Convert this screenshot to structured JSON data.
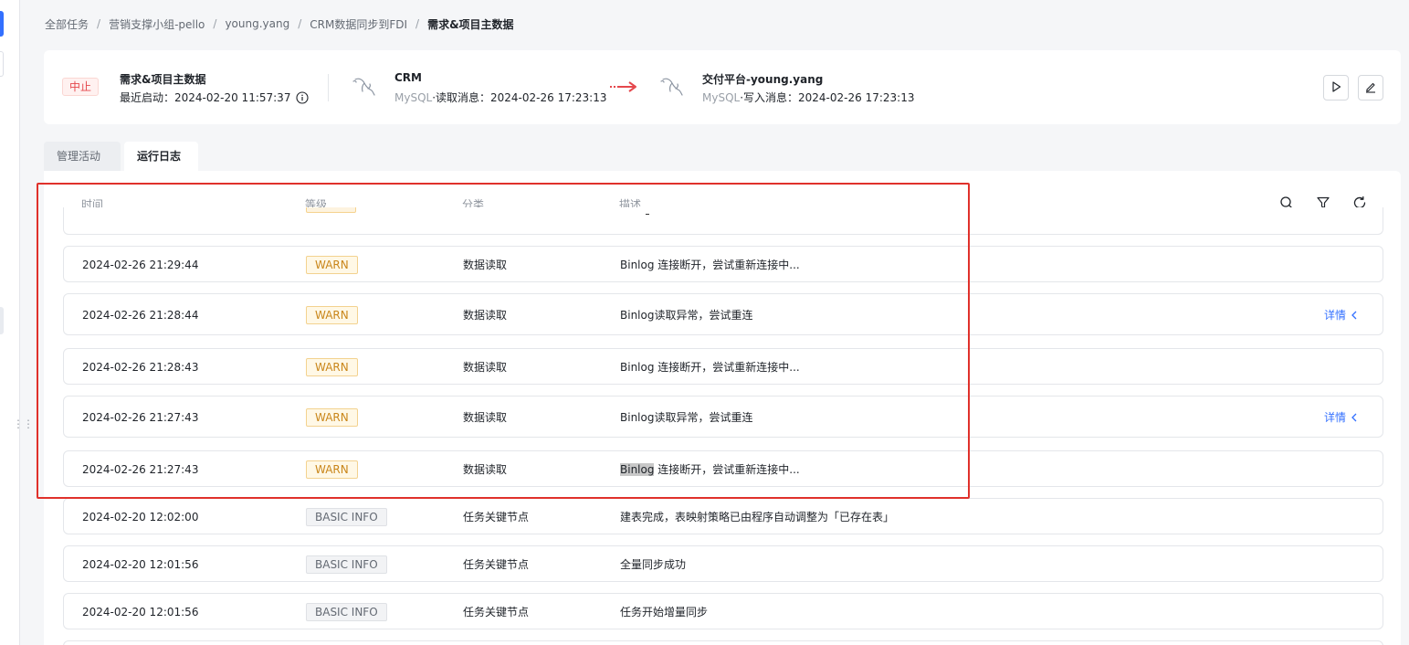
{
  "breadcrumb": [
    "全部任务",
    "营销支撑小组-pello",
    "young.yang",
    "CRM数据同步到FDI",
    "需求&项目主数据"
  ],
  "breadcrumb_separator": "/",
  "task": {
    "status": "中止",
    "title": "需求&项目主数据",
    "last_start": "最近启动：2024-02-20 11:57:37"
  },
  "source": {
    "name": "CRM",
    "db_type": "MySQL",
    "detail": "·读取消息：2024-02-26 17:23:13",
    "icon": "mysql-dolphin-icon"
  },
  "target": {
    "name": "交付平台-young.yang",
    "db_type": "MySQL",
    "detail": "·写入消息：2024-02-26 17:23:13",
    "icon": "mysql-dolphin-icon"
  },
  "tabs": [
    {
      "label": "管理活动",
      "active": false
    },
    {
      "label": "运行日志",
      "active": true
    }
  ],
  "table": {
    "columns": [
      "时间",
      "等级",
      "分类",
      "描述"
    ],
    "detail_label": "详情",
    "rows": [
      {
        "time": "2024-02-26 21:29:44",
        "level": "WARN",
        "category": "数据读取",
        "description": "Binlog 连接断开，尝试重新连接中...",
        "has_detail": false
      },
      {
        "time": "2024-02-26 21:28:44",
        "level": "WARN",
        "category": "数据读取",
        "description": "Binlog读取异常，尝试重连",
        "has_detail": true
      },
      {
        "time": "2024-02-26 21:28:43",
        "level": "WARN",
        "category": "数据读取",
        "description": "Binlog 连接断开，尝试重新连接中...",
        "has_detail": false
      },
      {
        "time": "2024-02-26 21:27:43",
        "level": "WARN",
        "category": "数据读取",
        "description": "Binlog读取异常，尝试重连",
        "has_detail": true
      },
      {
        "time": "2024-02-26 21:27:43",
        "level": "WARN",
        "category": "数据读取",
        "description_highlight": "Binlog",
        "description_rest": " 连接断开，尝试重新连接中...",
        "has_detail": false
      },
      {
        "time": "2024-02-20 12:02:00",
        "level": "BASIC INFO",
        "category": "任务关键节点",
        "description": "建表完成，表映射策略已由程序自动调整为「已存在表」",
        "has_detail": false
      },
      {
        "time": "2024-02-20 12:01:56",
        "level": "BASIC INFO",
        "category": "任务关键节点",
        "description": "全量同步成功",
        "has_detail": false
      },
      {
        "time": "2024-02-20 12:01:56",
        "level": "BASIC INFO",
        "category": "任务关键节点",
        "description": "任务开始增量同步",
        "has_detail": false
      }
    ]
  },
  "colors": {
    "accent": "#3370ff",
    "stop_red": "#e5484d",
    "warn": "#c9861a",
    "annotation_red": "#e0312b"
  }
}
